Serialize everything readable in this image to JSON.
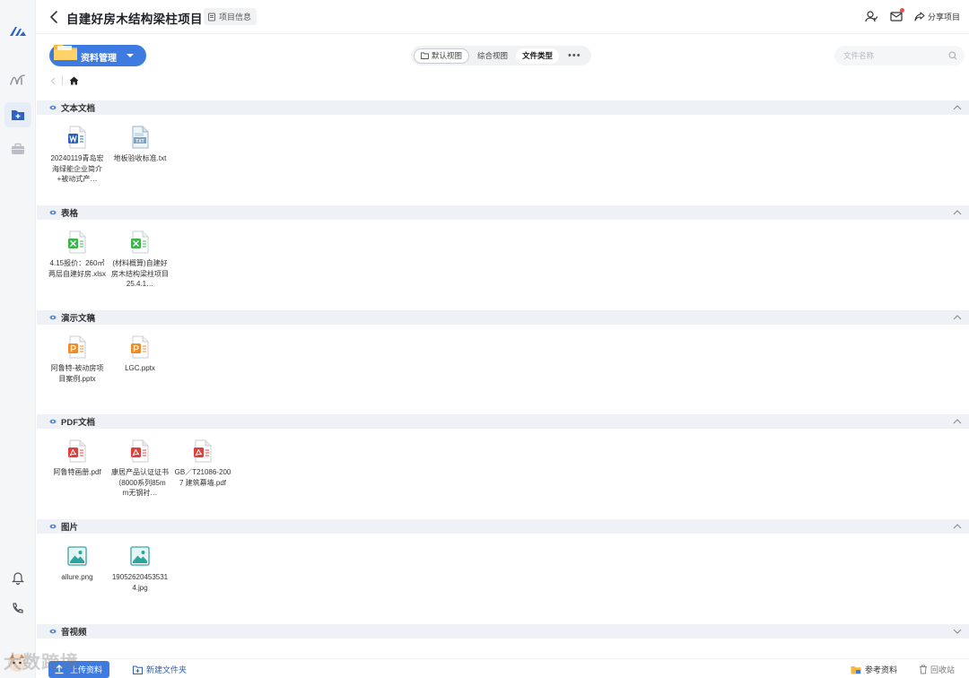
{
  "header": {
    "title": "自建好房木结构梁柱项目",
    "project_info_label": "项目信息",
    "share_label": "分享项目"
  },
  "toolbar": {
    "manager_label": "资料管理",
    "view_tabs": [
      "默认视图",
      "综合视图",
      "文件类型"
    ],
    "more_label": "•••",
    "search_placeholder": "文件名称"
  },
  "sections": [
    {
      "title": "文本文档",
      "expanded": true,
      "files": [
        {
          "name": "20240119青岛宏海绿能企业简介+被动式产…",
          "type": "word"
        },
        {
          "name": "地板验收标准.txt",
          "type": "txt"
        }
      ]
    },
    {
      "title": "表格",
      "expanded": true,
      "files": [
        {
          "name": "4.15报价：260㎡两层自建好房.xlsx",
          "type": "excel"
        },
        {
          "name": "(材料概算)自建好房木结构梁柱项目25.4.1…",
          "type": "excel"
        }
      ]
    },
    {
      "title": "演示文稿",
      "expanded": true,
      "files": [
        {
          "name": "阿鲁特-被动房项目案例.pptx",
          "type": "ppt"
        },
        {
          "name": "LGC.pptx",
          "type": "ppt"
        }
      ]
    },
    {
      "title": "PDF文档",
      "expanded": true,
      "files": [
        {
          "name": "阿鲁特画册.pdf",
          "type": "pdf"
        },
        {
          "name": "康居产品认证证书（8000系列85mm无钢衬…",
          "type": "pdf"
        },
        {
          "name": "GB／T21086-2007 建筑幕墙.pdf",
          "type": "pdf"
        }
      ]
    },
    {
      "title": "图片",
      "expanded": true,
      "files": [
        {
          "name": "allure.png",
          "type": "image"
        },
        {
          "name": "190526204535314.jpg",
          "type": "image"
        }
      ]
    },
    {
      "title": "音视频",
      "expanded": false,
      "files": []
    }
  ],
  "bottom": {
    "upload_label": "上传资料",
    "new_folder_label": "新建文件夹",
    "refs_label": "参考资料",
    "trash_label": "回收站"
  },
  "watermark": "大数跨境",
  "colors": {
    "accent": "#3d7be0",
    "section_bg": "#eef1f5",
    "word": "#2b5fc2",
    "excel": "#3bb54a",
    "ppt": "#f08a2a",
    "pdf": "#e0403b",
    "image": "#2aa6a0"
  }
}
